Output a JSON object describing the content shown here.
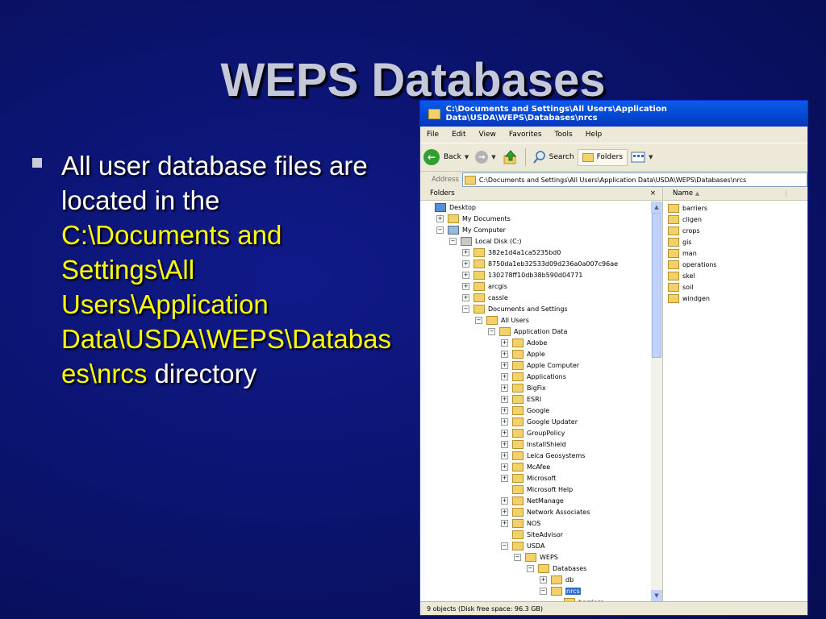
{
  "slide": {
    "title": "WEPS Databases",
    "bullet_prefix": "All user database files are located in the ",
    "bullet_path": "C:\\Documents and Settings\\All Users\\Application Data\\USDA\\WEPS\\Databases\\nrcs",
    "bullet_suffix": " directory"
  },
  "window": {
    "title": "C:\\Documents and Settings\\All Users\\Application Data\\USDA\\WEPS\\Databases\\nrcs",
    "menu": [
      "File",
      "Edit",
      "View",
      "Favorites",
      "Tools",
      "Help"
    ],
    "toolbar": {
      "back": "Back",
      "search": "Search",
      "folders": "Folders"
    },
    "address_label": "Address",
    "address_value": "C:\\Documents and Settings\\All Users\\Application Data\\USDA\\WEPS\\Databases\\nrcs",
    "folders_header": "Folders",
    "close_glyph": "×",
    "name_header": "Name",
    "status": "9 objects (Disk free space: 96.3 GB)",
    "tree": [
      {
        "label": "Desktop",
        "exp": "",
        "kind": "desk"
      },
      {
        "label": "My Documents",
        "exp": "+",
        "kind": "folder"
      },
      {
        "label": "My Computer",
        "exp": "−",
        "kind": "comp"
      },
      {
        "label": "Local Disk (C:)",
        "exp": "−",
        "kind": "disk"
      },
      {
        "label": "382e1d4a1ca5235bd0",
        "exp": "+",
        "kind": "folder"
      },
      {
        "label": "8750da1eb32533d09d236a0a007c96ae",
        "exp": "+",
        "kind": "folder"
      },
      {
        "label": "130278ff10db38b590d04771",
        "exp": "+",
        "kind": "folder"
      },
      {
        "label": "arcgis",
        "exp": "+",
        "kind": "folder"
      },
      {
        "label": "cassle",
        "exp": "+",
        "kind": "folder"
      },
      {
        "label": "Documents and Settings",
        "exp": "−",
        "kind": "folder"
      },
      {
        "label": "All Users",
        "exp": "−",
        "kind": "folder"
      },
      {
        "label": "Application Data",
        "exp": "−",
        "kind": "folder"
      },
      {
        "label": "Adobe",
        "exp": "+",
        "kind": "folder"
      },
      {
        "label": "Apple",
        "exp": "+",
        "kind": "folder"
      },
      {
        "label": "Apple Computer",
        "exp": "+",
        "kind": "folder"
      },
      {
        "label": "Applications",
        "exp": "+",
        "kind": "folder"
      },
      {
        "label": "BigFix",
        "exp": "+",
        "kind": "folder"
      },
      {
        "label": "ESRI",
        "exp": "+",
        "kind": "folder"
      },
      {
        "label": "Google",
        "exp": "+",
        "kind": "folder"
      },
      {
        "label": "Google Updater",
        "exp": "+",
        "kind": "folder"
      },
      {
        "label": "GroupPolicy",
        "exp": "+",
        "kind": "folder"
      },
      {
        "label": "InstallShield",
        "exp": "+",
        "kind": "folder"
      },
      {
        "label": "Leica Geosystems",
        "exp": "+",
        "kind": "folder"
      },
      {
        "label": "McAfee",
        "exp": "+",
        "kind": "folder"
      },
      {
        "label": "Microsoft",
        "exp": "+",
        "kind": "folder"
      },
      {
        "label": "Microsoft Help",
        "exp": "",
        "kind": "folder"
      },
      {
        "label": "NetManage",
        "exp": "+",
        "kind": "folder"
      },
      {
        "label": "Network Associates",
        "exp": "+",
        "kind": "folder"
      },
      {
        "label": "NOS",
        "exp": "+",
        "kind": "folder"
      },
      {
        "label": "SiteAdvisor",
        "exp": "",
        "kind": "folder"
      },
      {
        "label": "USDA",
        "exp": "−",
        "kind": "folder"
      },
      {
        "label": "WEPS",
        "exp": "−",
        "kind": "folder"
      },
      {
        "label": "Databases",
        "exp": "−",
        "kind": "folder"
      },
      {
        "label": "db",
        "exp": "+",
        "kind": "folder"
      },
      {
        "label": "nrcs",
        "exp": "−",
        "kind": "folder",
        "selected": true
      },
      {
        "label": "barriers",
        "exp": "",
        "kind": "folder"
      }
    ],
    "tree_levels": [
      0,
      1,
      1,
      2,
      3,
      3,
      3,
      3,
      3,
      3,
      4,
      5,
      6,
      6,
      6,
      6,
      6,
      6,
      6,
      6,
      6,
      6,
      6,
      6,
      6,
      6,
      6,
      6,
      6,
      6,
      6,
      7,
      8,
      9,
      9,
      10
    ],
    "files": [
      "barriers",
      "cligen",
      "crops",
      "gis",
      "man",
      "operations",
      "skel",
      "soil",
      "windgen"
    ]
  }
}
